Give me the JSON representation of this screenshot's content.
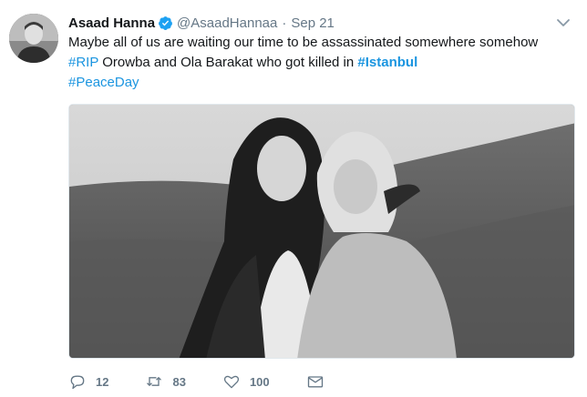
{
  "tweet": {
    "author_name": "Asaad Hanna",
    "handle": "@AsaadHannaa",
    "separator": "·",
    "date": "Sep 21",
    "text": {
      "line1": "Maybe all of us are waiting our time to be assassinated somewhere somehow",
      "hashtag_rip": "#RIP",
      "line2_mid": " Orowba and Ola Barakat who got killed in ",
      "hashtag_istanbul": "#Istanbul",
      "hashtag_peaceday": "#PeaceDay"
    },
    "photo_alt": "Black and white photo of two women smiling outdoors",
    "actions": {
      "replies": "12",
      "retweets": "83",
      "likes": "100"
    },
    "icons": {
      "verified": "verified-badge-icon",
      "caret": "chevron-down-icon",
      "reply": "reply-icon",
      "retweet": "retweet-icon",
      "like": "heart-icon",
      "message": "envelope-icon"
    },
    "colors": {
      "link": "#1b95e0",
      "secondary": "#657786",
      "primary_text": "#14171a"
    }
  }
}
